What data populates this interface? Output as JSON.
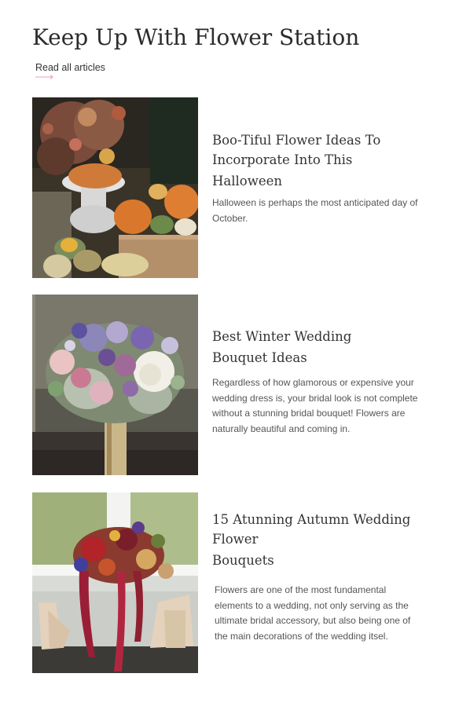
{
  "header": {
    "title": "Keep Up With Flower Station",
    "read_all_label": "Read all articles",
    "accent_color": "#e8a0aa"
  },
  "articles": [
    {
      "title_lines": [
        "Boo-Tiful Flower Ideas To",
        "Incorporate Into This",
        "Halloween"
      ],
      "excerpt": "Halloween is perhaps the most anticipated day of October.",
      "image": "halloween-pumpkin-arrangement-photo"
    },
    {
      "title_lines": [
        "Best Winter Wedding",
        "Bouquet Ideas"
      ],
      "excerpt": "Regardless of how glamorous or expensive your wedding dress is, your bridal look is not complete without a stunning bridal bouquet! Flowers are naturally beautiful and coming in.",
      "image": "winter-wedding-bouquet-photo"
    },
    {
      "title_lines": [
        "15 Atunning Autumn Wedding",
        "Flower",
        "Bouquets"
      ],
      "excerpt": "Flowers are one of the most fundamental elements to a wedding, not only serving as the ultimate bridal accessory, but also being one of the main decorations of the wedding itsel.",
      "image": "autumn-cascade-bouquet-photo"
    }
  ]
}
